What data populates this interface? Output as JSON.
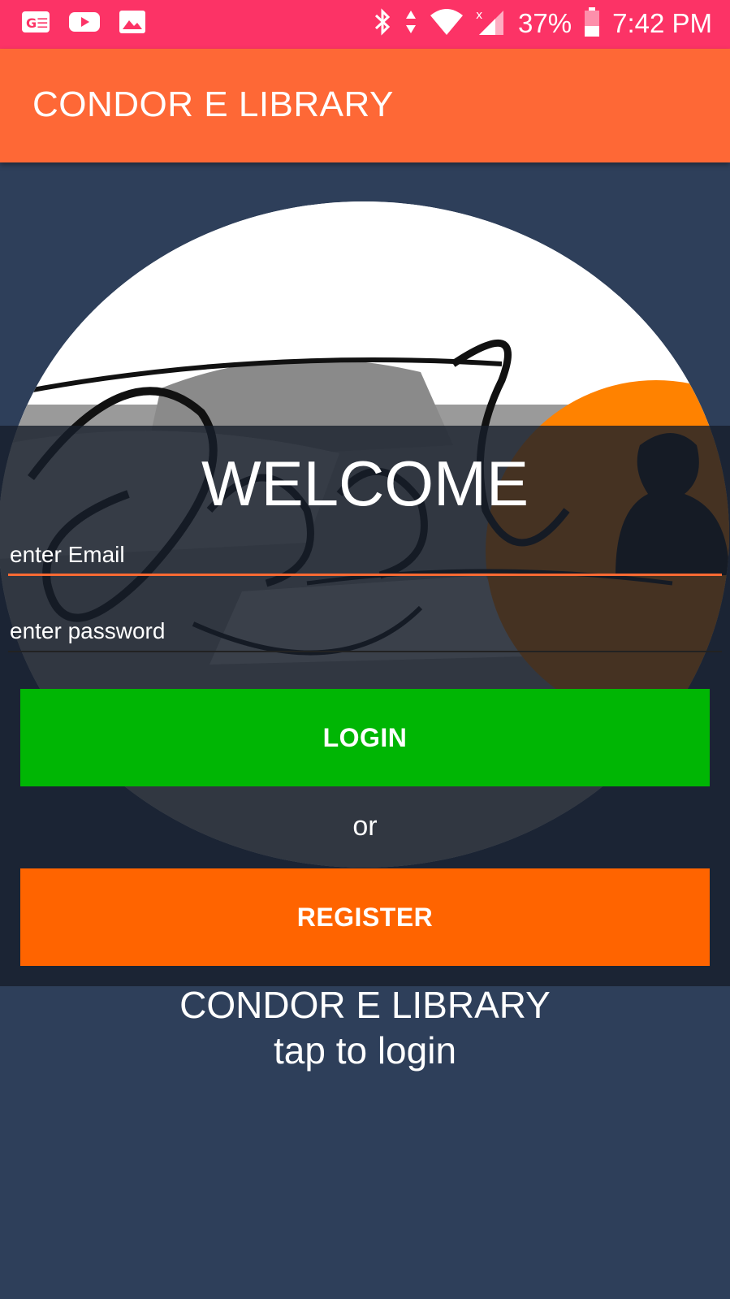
{
  "status_bar": {
    "battery": "37%",
    "time": "7:42 PM",
    "icons": [
      "ge-icon",
      "youtube-icon",
      "image-icon",
      "bluetooth-icon",
      "data-arrows-icon",
      "wifi-icon",
      "signal-icon",
      "battery-icon"
    ]
  },
  "app_bar": {
    "title": "CONDOR E LIBRARY"
  },
  "login": {
    "welcome": "WELCOME",
    "email_placeholder": "enter Email",
    "password_placeholder": "enter password",
    "login_label": "LOGIN",
    "or_label": "or",
    "register_label": "REGISTER"
  },
  "footer": {
    "title": "CONDOR E LIBRARY",
    "subtitle": "tap to login"
  },
  "colors": {
    "status_bar": "#fc3366",
    "app_bar": "#fe6836",
    "background": "#2e3f5a",
    "login_button": "#00b604",
    "register_button": "#ff6400",
    "active_underline": "#ff6a33"
  }
}
